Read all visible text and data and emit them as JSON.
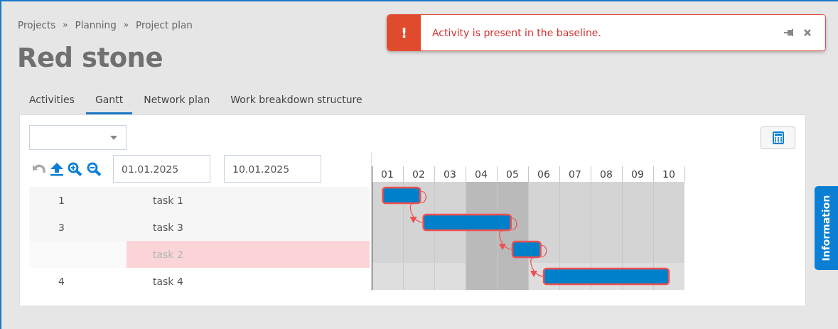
{
  "breadcrumb": [
    "Projects",
    "Planning",
    "Project plan"
  ],
  "breadcrumb_separator": "»",
  "title": "Red stone",
  "tabs": [
    {
      "label": "Activities",
      "selected": false
    },
    {
      "label": "Gantt",
      "selected": true
    },
    {
      "label": "Network plan",
      "selected": false
    },
    {
      "label": "Work breakdown structure",
      "selected": false
    }
  ],
  "toast": {
    "kind": "error",
    "icon": "!",
    "message": "Activity is present in the baseline."
  },
  "toolbar": {
    "undo_disabled": true
  },
  "date_from": "01.01.2025",
  "date_to": "10.01.2025",
  "rows": [
    {
      "number": "1",
      "name": "task 1",
      "highlighted": false
    },
    {
      "number": "3",
      "name": "task 3",
      "highlighted": false
    },
    {
      "name": "task 2",
      "highlighted": true
    },
    {
      "number": "4",
      "name": "task 4",
      "highlighted": false
    }
  ],
  "days": [
    {
      "label": "01",
      "weekend": false
    },
    {
      "label": "02",
      "weekend": false
    },
    {
      "label": "03",
      "weekend": false
    },
    {
      "label": "04",
      "weekend": true
    },
    {
      "label": "05",
      "weekend": true
    },
    {
      "label": "06",
      "weekend": false
    },
    {
      "label": "07",
      "weekend": false
    },
    {
      "label": "08",
      "weekend": false
    },
    {
      "label": "09",
      "weekend": false
    },
    {
      "label": "10",
      "weekend": false
    }
  ],
  "side_tab": "Information"
}
